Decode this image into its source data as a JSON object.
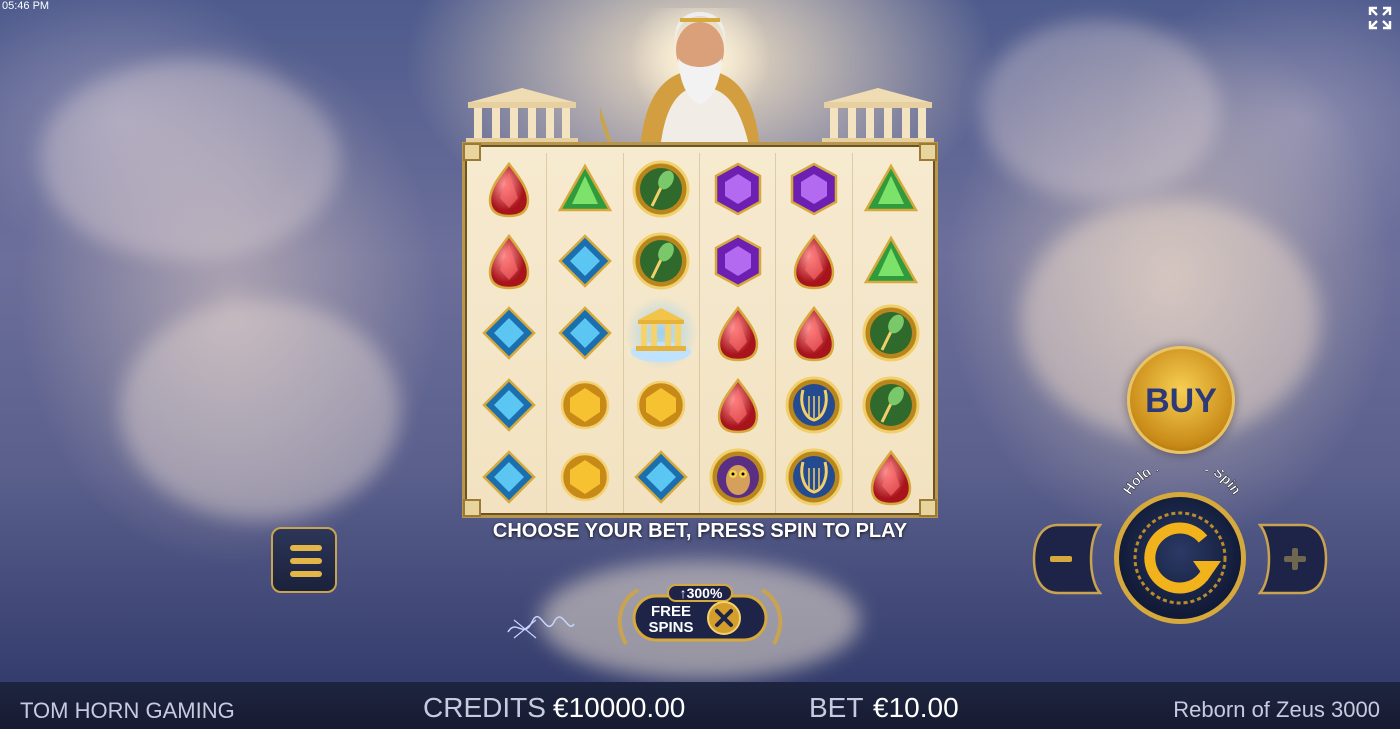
{
  "status": {
    "time": "05:46 PM"
  },
  "message": "CHOOSE YOUR BET, PRESS SPIN TO PLAY",
  "free_spins": {
    "label_line1": "FREE",
    "label_line2": "SPINS",
    "boost": "↑300%"
  },
  "buy_label": "BUY",
  "spin_hint": "Hold for Nitro Spin",
  "bottom_bar": {
    "brand": "TOM HORN GAMING",
    "credits_label": "CREDITS",
    "credits_value": "€10000.00",
    "bet_label": "BET",
    "bet_value": "€10.00",
    "game_title": "Reborn of Zeus 3000"
  },
  "reels": [
    [
      "red-gem",
      "green-gem",
      "feather-coin",
      "purple-gem",
      "purple-gem",
      "green-gem"
    ],
    [
      "red-gem",
      "blue-gem",
      "feather-coin",
      "purple-gem",
      "red-gem",
      "green-gem"
    ],
    [
      "blue-gem",
      "blue-gem",
      "temple-scatter",
      "red-gem",
      "red-gem",
      "feather-coin"
    ],
    [
      "blue-gem",
      "gold-gem",
      "gold-gem",
      "red-gem",
      "lyre-coin",
      "feather-coin"
    ],
    [
      "blue-gem",
      "gold-gem",
      "blue-gem",
      "owl-coin",
      "lyre-coin",
      "red-gem"
    ]
  ],
  "colors": {
    "gold": "#d6a93c",
    "navy": "#1e2540",
    "buy_text": "#2d3a78"
  }
}
